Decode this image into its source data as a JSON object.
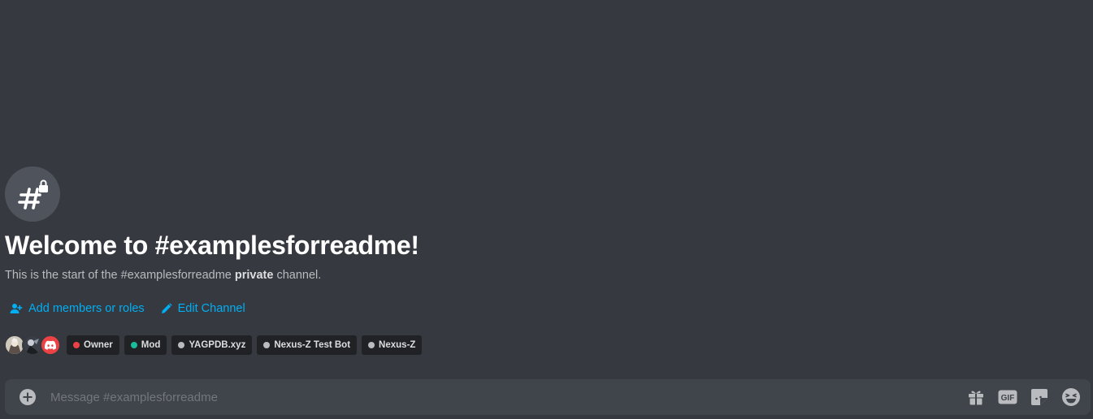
{
  "channel": {
    "welcome_title": "Welcome to #examplesforreadme!",
    "desc_prefix": "This is the start of the #examplesforreadme ",
    "desc_bold": "private",
    "desc_suffix": " channel."
  },
  "actions": {
    "add_members_label": "Add members or roles",
    "edit_channel_label": "Edit Channel"
  },
  "roles": [
    {
      "name": "Owner",
      "color": "#ed4245"
    },
    {
      "name": "Mod",
      "color": "#1abc9c"
    },
    {
      "name": "YAGPDB.xyz",
      "color": "#b9bbbe"
    },
    {
      "name": "Nexus-Z Test Bot",
      "color": "#b9bbbe"
    },
    {
      "name": "Nexus-Z",
      "color": "#b9bbbe"
    }
  ],
  "composer": {
    "placeholder": "Message #examplesforreadme",
    "gif_label": "GIF"
  },
  "colors": {
    "background": "#36393f",
    "link": "#00aff4",
    "composer": "#40444b",
    "icon_gray": "#b9bbbe"
  },
  "icons": {
    "channel": "private-channel-hash-lock-icon",
    "add_members": "add-members-icon",
    "edit": "pencil-icon",
    "attach": "plus-circle-icon",
    "gift": "gift-icon",
    "gif": "gif-icon",
    "sticker": "sticker-icon",
    "emoji": "emoji-icon"
  }
}
